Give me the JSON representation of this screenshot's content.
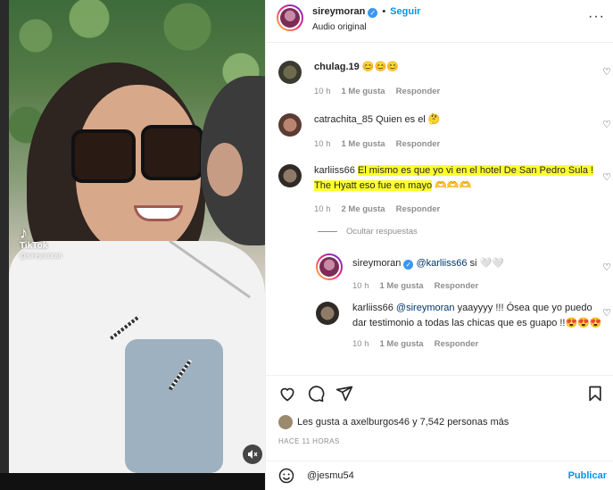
{
  "video": {
    "watermark_brand": "TikTok",
    "watermark_handle": "@sireymoran",
    "mute_icon": "speaker-muted-icon"
  },
  "header": {
    "username": "sireymoran",
    "follow_label": "Seguir",
    "audio_label": "Audio original",
    "more_icon": "more-options-icon"
  },
  "comments": [
    {
      "username": "chulag.19",
      "text": "😊😊😊",
      "time": "10 h",
      "likes": "1 Me gusta",
      "reply": "Responder"
    },
    {
      "username": "catrachita_85",
      "text": "Quien es el 🤔",
      "time": "10 h",
      "likes": "1 Me gusta",
      "reply": "Responder"
    },
    {
      "username": "karliiss66",
      "text_line1": "El mismo es que yo vi en el hotel De San Pedro Sula !",
      "text_line2": "The Hyatt eso fue en mayo",
      "text_emoji": "🫶🫶🫶",
      "time": "10 h",
      "likes": "2 Me gusta",
      "reply": "Responder"
    }
  ],
  "replies_toggle": "Ocultar respuestas",
  "replies": [
    {
      "username": "sireymoran",
      "mention": "@karliiss66",
      "text": "si 🤍🤍",
      "time": "10 h",
      "likes": "1 Me gusta",
      "reply": "Responder"
    },
    {
      "username": "karliiss66",
      "mention": "@sireymoran",
      "text_line1": "yaayyyy !!! Ósea que yo puedo",
      "text_line2": "dar testimonio a todas las chicas que es guapo !!😍😍😍",
      "time": "10 h",
      "likes": "1 Me gusta",
      "reply": "Responder"
    }
  ],
  "actions": {
    "like_icon": "heart-icon",
    "comment_icon": "comment-icon",
    "share_icon": "send-icon",
    "save_icon": "bookmark-icon"
  },
  "likes": {
    "prefix": "Les gusta a",
    "user": "axelburgos46",
    "suffix": "y 7,542 personas más"
  },
  "timestamp": "HACE 11 HORAS",
  "composer": {
    "emoji_icon": "smiley-icon",
    "value": "@jesmu54",
    "post_label": "Publicar"
  },
  "colors": {
    "accent": "#0095f6",
    "highlight": "#ffff2e",
    "muted": "#8e8e8e"
  }
}
